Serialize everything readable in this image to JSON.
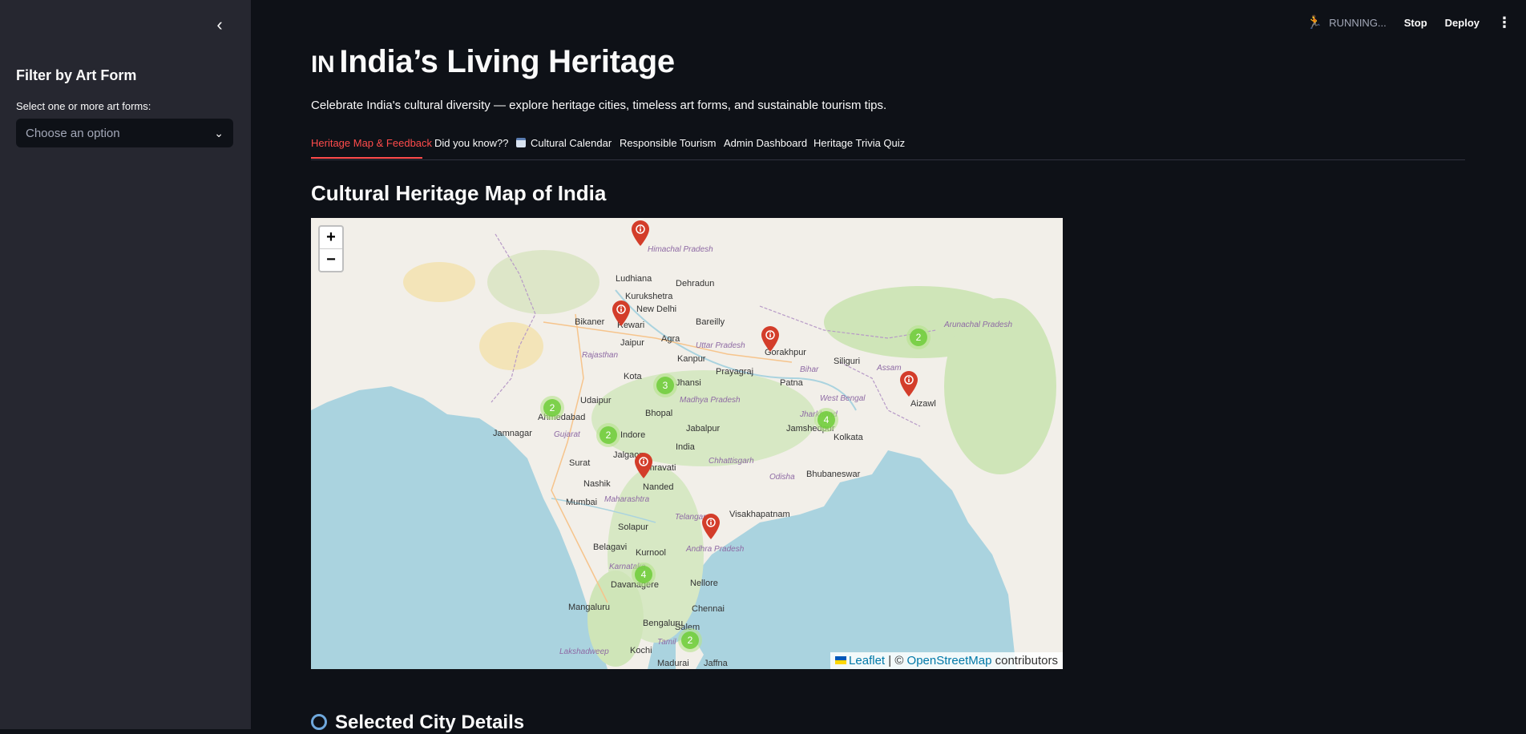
{
  "sidebar": {
    "collapse_icon": "chevron-left-icon",
    "title": "Filter by Art Form",
    "label": "Select one or more art forms:",
    "select_placeholder": "Choose an option"
  },
  "header": {
    "status": "RUNNING...",
    "stop": "Stop",
    "deploy": "Deploy"
  },
  "main": {
    "flag": "IN",
    "title": "India’s Living Heritage",
    "subtitle": "Celebrate India's cultural diversity — explore heritage cities, timeless art forms, and sustainable tourism tips.",
    "tabs": [
      {
        "label": "Heritage Map & Feedback"
      },
      {
        "label": "Did you know??"
      },
      {
        "label": "Cultural Calendar"
      },
      {
        "label": "Responsible Tourism"
      },
      {
        "label": "Admin Dashboard"
      },
      {
        "label": "Heritage Trivia Quiz"
      }
    ],
    "section_title": "Cultural Heritage Map of India",
    "bottom_section": "Selected City Details"
  },
  "map": {
    "zoom_in": "+",
    "zoom_out": "−",
    "attribution": {
      "leaflet": "Leaflet",
      "sep": " | © ",
      "osm": "OpenStreetMap",
      "suffix": " contributors"
    },
    "clusters": [
      "2",
      "3",
      "2",
      "2",
      "4",
      "4",
      "2"
    ],
    "cities": [
      "Ludhiana",
      "Dehradun",
      "Kurukshetra",
      "New Delhi",
      "Bikaner",
      "Rewari",
      "Bareilly",
      "Jaipur",
      "Agra",
      "Uttar Pradesh",
      "Kanpur",
      "Gorakhpur",
      "Siliguri",
      "Rajasthan",
      "Kota",
      "Jhansi",
      "Prayagraj",
      "Bihar",
      "Patna",
      "Assam",
      "Udaipur",
      "Madhya Pradesh",
      "West Bengal",
      "Aizawl",
      "Ahmedabad",
      "Bhopal",
      "Jamshedpur",
      "Jharkhand",
      "Kolkata",
      "Jamnagar",
      "Gujarat",
      "Indore",
      "Jabalpur",
      "India",
      "Jalgaon",
      "Chhattisgarh",
      "Surat",
      "Amravati",
      "Nashik",
      "Nanded",
      "Odisha",
      "Bhubaneswar",
      "Mumbai",
      "Maharashtra",
      "Telangana",
      "Visakhapatnam",
      "Solapur",
      "Belagavi",
      "Kurnool",
      "Andhra Pradesh",
      "Karnataka",
      "Davanagere",
      "Nellore",
      "Mangaluru",
      "Chennai",
      "Bengaluru",
      "Salem",
      "Lakshadweep",
      "Tamil",
      "Kochi",
      "Madurai",
      "Jaffna",
      "Himachal Pradesh",
      "Arunachal Pradesh"
    ]
  }
}
